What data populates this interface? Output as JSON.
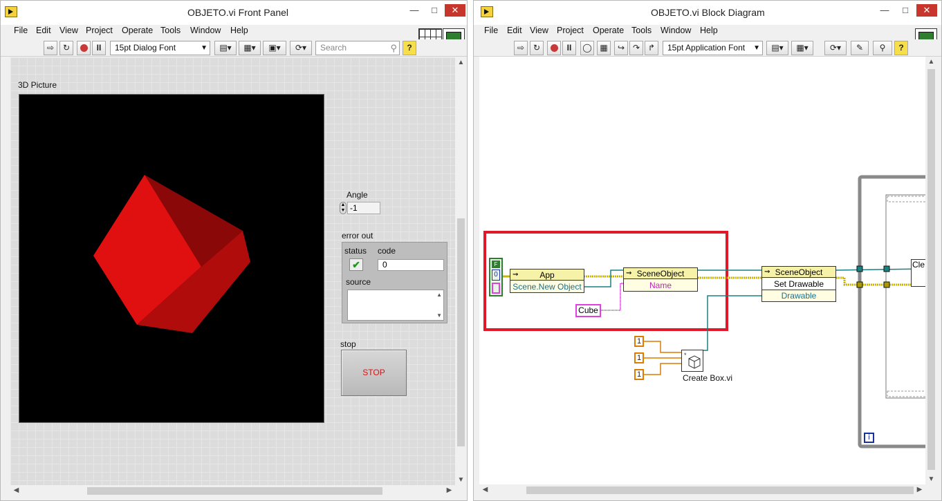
{
  "front_panel": {
    "title": "OBJETO.vi Front Panel",
    "menu": [
      "File",
      "Edit",
      "View",
      "Project",
      "Operate",
      "Tools",
      "Window",
      "Help"
    ],
    "font_select": "15pt Dialog Font",
    "search_placeholder": "Search",
    "picture_label": "3D Picture",
    "angle_label": "Angle",
    "angle_value": "-1",
    "error_out_label": "error out",
    "status_label": "status",
    "code_label": "code",
    "code_value": "0",
    "source_label": "source",
    "stop_label": "stop",
    "stop_button": "STOP"
  },
  "block_diagram": {
    "title": "OBJETO.vi Block Diagram",
    "menu": [
      "File",
      "Edit",
      "View",
      "Project",
      "Operate",
      "Tools",
      "Window",
      "Help"
    ],
    "font_select": "15pt Application Font",
    "app_node_header": "App",
    "app_node_property": "Scene.New Object",
    "scene_object_header": "SceneObject",
    "scene_object_name": "Name",
    "scene_object2_header": "SceneObject",
    "set_drawable": "Set Drawable",
    "drawable": "Drawable",
    "cube_const": "Cube",
    "num_consts": [
      "1",
      "1",
      "1"
    ],
    "create_box_label": "Create Box.vi",
    "bool_const": "F",
    "num_zero": "0",
    "loop_index": "i",
    "partial_node": "Cle"
  },
  "colors": {
    "highlight_rect": "#e0182a",
    "cube_face_front": "#e01010",
    "cube_face_side": "#b00c0c",
    "cube_face_top": "#8a0808",
    "wire_teal": "#1a8080",
    "wire_yellow": "#c8b400",
    "wire_pink": "#e040e0",
    "wire_orange": "#e07b00"
  }
}
